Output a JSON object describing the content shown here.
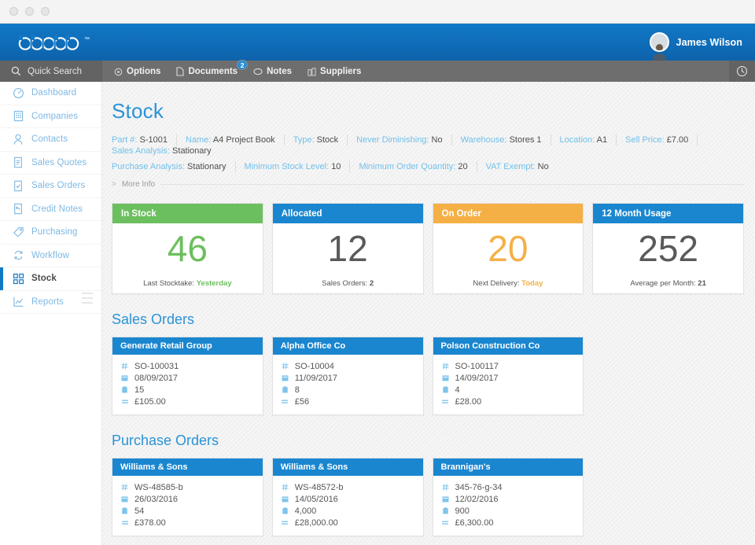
{
  "window": {
    "dots": 3
  },
  "brand": {
    "logo_text": "omono",
    "trademark": "™",
    "user_name": "James Wilson",
    "avatar_icon": "user-avatar"
  },
  "tabbar": {
    "quick_search": {
      "label": "Quick Search",
      "icon": "search-icon"
    },
    "tabs": [
      {
        "label": "Options",
        "icon": "gear-icon",
        "badge": null
      },
      {
        "label": "Documents",
        "icon": "document-icon",
        "badge": "2"
      },
      {
        "label": "Notes",
        "icon": "note-icon",
        "badge": null
      },
      {
        "label": "Suppliers",
        "icon": "suppliers-icon",
        "badge": null
      }
    ],
    "clock_icon": "clock-icon"
  },
  "sidebar": {
    "items": [
      {
        "label": "Dashboard",
        "icon": "gauge-icon",
        "active": false
      },
      {
        "label": "Companies",
        "icon": "building-icon",
        "active": false
      },
      {
        "label": "Contacts",
        "icon": "person-icon",
        "active": false
      },
      {
        "label": "Sales Quotes",
        "icon": "doc-lines-icon",
        "active": false
      },
      {
        "label": "Sales Orders",
        "icon": "doc-check-icon",
        "active": false
      },
      {
        "label": "Credit Notes",
        "icon": "doc-back-icon",
        "active": false
      },
      {
        "label": "Purchasing",
        "icon": "tag-icon",
        "active": false
      },
      {
        "label": "Workflow",
        "icon": "swap-icon",
        "active": false
      },
      {
        "label": "Stock",
        "icon": "blocks-icon",
        "active": true
      },
      {
        "label": "Reports",
        "icon": "chart-icon",
        "active": false
      }
    ],
    "collapse_icon": "collapse-sidebar-icon"
  },
  "page": {
    "title": "Stock",
    "meta_rows": [
      [
        {
          "key": "Part #:",
          "value": "S-1001"
        },
        {
          "key": "Name:",
          "value": "A4 Project Book"
        },
        {
          "key": "Type:",
          "value": "Stock"
        },
        {
          "key": "Never Diminishing:",
          "value": "No"
        },
        {
          "key": "Warehouse:",
          "value": "Stores 1"
        },
        {
          "key": "Location:",
          "value": "A1"
        },
        {
          "key": "Sell Price:",
          "value": "£7.00"
        },
        {
          "key": "Sales Analysis:",
          "value": "Stationary"
        }
      ],
      [
        {
          "key": "Purchase Analysis:",
          "value": "Stationary"
        },
        {
          "key": "Minimum Stock Level:",
          "value": "10"
        },
        {
          "key": "Minimum Order Quantity:",
          "value": "20"
        },
        {
          "key": "VAT Exempt:",
          "value": "No"
        }
      ]
    ],
    "more_info": {
      "label": "More Info",
      "chevron": ">"
    }
  },
  "kpis": [
    {
      "title": "In Stock",
      "value": "46",
      "head_color": "#6cbf5e",
      "value_color": "#6cbf5e",
      "foot_label": "Last Stocktake:",
      "foot_value": "Yesterday",
      "foot_value_color": "#6cbf5e"
    },
    {
      "title": "Allocated",
      "value": "12",
      "head_color": "#1a86cf",
      "value_color": "#5a5a5a",
      "foot_label": "Sales Orders:",
      "foot_value": "2",
      "foot_value_color": "#4a4a4a"
    },
    {
      "title": "On Order",
      "value": "20",
      "head_color": "#f5b045",
      "value_color": "#f5b045",
      "foot_label": "Next Delivery:",
      "foot_value": "Today",
      "foot_value_color": "#f5b045"
    },
    {
      "title": "12 Month Usage",
      "value": "252",
      "head_color": "#1a86cf",
      "value_color": "#5a5a5a",
      "foot_label": "Average per Month:",
      "foot_value": "21",
      "foot_value_color": "#4a4a4a"
    }
  ],
  "sales_orders": {
    "title": "Sales Orders",
    "cards": [
      {
        "company": "Generate Retail Group",
        "ref": "SO-100031",
        "date": "08/09/2017",
        "qty": "15",
        "total": "£105.00"
      },
      {
        "company": "Alpha Office Co",
        "ref": "SO-10004",
        "date": "11/09/2017",
        "qty": "8",
        "total": "£56"
      },
      {
        "company": "Polson Construction Co",
        "ref": "SO-100117",
        "date": "14/09/2017",
        "qty": "4",
        "total": "£28.00"
      }
    ]
  },
  "purchase_orders": {
    "title": "Purchase Orders",
    "cards": [
      {
        "company": "Williams & Sons",
        "ref": "WS-48585-b",
        "date": "26/03/2016",
        "qty": "54",
        "total": "£378.00"
      },
      {
        "company": "Williams & Sons",
        "ref": "WS-48572-b",
        "date": "14/05/2016",
        "qty": "4,000",
        "total": "£28,000.00"
      },
      {
        "company": "Brannigan's",
        "ref": "345-76-g-34",
        "date": "12/02/2016",
        "qty": "900",
        "total": "£6,300.00"
      }
    ]
  },
  "line_icons": {
    "ref": "hash-icon",
    "date": "calendar-icon",
    "qty": "box-icon",
    "total": "equals-icon"
  },
  "colors": {
    "brand_blue": "#1279c6",
    "accent_blue": "#2a93d8",
    "green": "#6cbf5e",
    "amber": "#f5b045",
    "tab_grey": "#6e6e6e"
  }
}
